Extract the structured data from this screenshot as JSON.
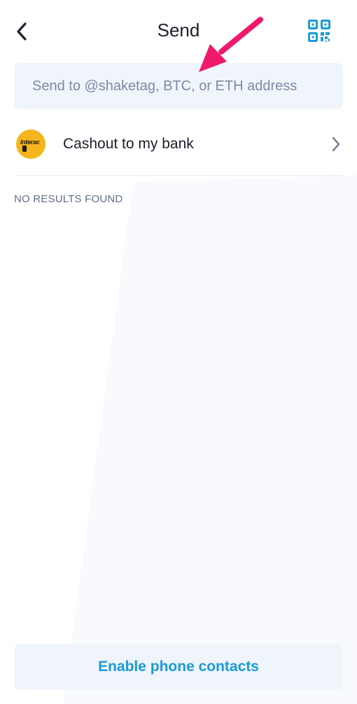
{
  "header": {
    "title": "Send",
    "back_icon": "chevron-left-icon",
    "qr_icon": "qr-code-icon"
  },
  "search": {
    "placeholder": "Send to @shaketag, BTC, or ETH address",
    "value": ""
  },
  "cashout": {
    "logo_text": "Interac",
    "label": "Cashout to my bank",
    "chevron_icon": "chevron-right-icon"
  },
  "results": {
    "empty_text": "NO RESULTS FOUND"
  },
  "footer": {
    "enable_contacts_label": "Enable phone contacts"
  },
  "colors": {
    "accent": "#1a9bd8",
    "field_background": "#f0f5fc",
    "placeholder": "#7c8aa3",
    "muted_text": "#5e6e88",
    "interac_yellow": "#f6b51d",
    "annotation_arrow": "#f0196c"
  },
  "annotation": {
    "arrow_icon": "annotation-arrow-icon"
  }
}
